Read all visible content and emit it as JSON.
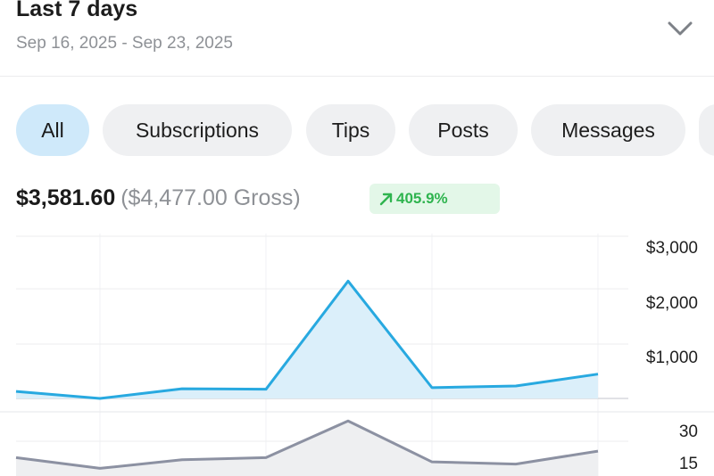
{
  "header": {
    "period_label": "Last 7 days",
    "date_range": "Sep 16, 2025 - Sep 23, 2025",
    "dropdown_icon": "chevron-down-icon"
  },
  "filters": {
    "tabs": [
      {
        "label": "All",
        "active": true
      },
      {
        "label": "Subscriptions",
        "active": false
      },
      {
        "label": "Tips",
        "active": false
      },
      {
        "label": "Posts",
        "active": false
      },
      {
        "label": "Messages",
        "active": false
      },
      {
        "label": "",
        "active": false
      }
    ]
  },
  "summary": {
    "net": "$3,581.60",
    "gross": "($4,477.00 Gross)",
    "change": "405.9%",
    "change_icon": "trend-up-arrow-icon"
  },
  "colors": {
    "accent": "#28a9e0",
    "accent_fill": "#dbeffa",
    "secondary_line": "#8c91a2",
    "positive": "#2fb44f",
    "active_chip": "#cfe9fa",
    "chip": "#eff0f2"
  },
  "chart_data": [
    {
      "type": "area",
      "x": [
        1,
        2,
        3,
        4,
        5,
        6,
        7
      ],
      "values": [
        130,
        0,
        180,
        170,
        2170,
        200,
        230,
        450
      ],
      "y_ticks": [
        "$3,000",
        "$2,000",
        "$1,000"
      ],
      "ylim": [
        0,
        3000
      ],
      "grid": true
    },
    {
      "type": "line",
      "x": [
        1,
        2,
        3,
        4,
        5,
        6,
        7
      ],
      "values": [
        16,
        11,
        15,
        16,
        33,
        14,
        13,
        19
      ],
      "y_ticks": [
        "30",
        "15"
      ],
      "ylim": [
        0,
        36
      ],
      "grid": true
    }
  ]
}
